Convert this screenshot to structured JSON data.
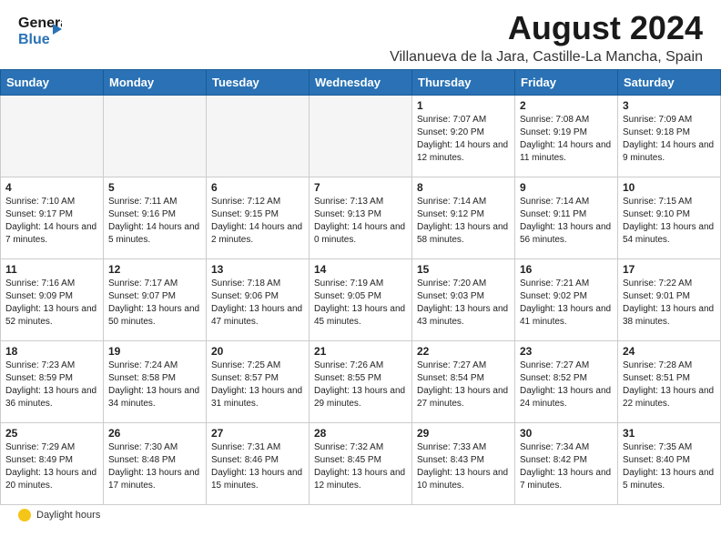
{
  "header": {
    "logo_line1": "General",
    "logo_line2": "Blue",
    "title": "August 2024",
    "subtitle": "Villanueva de la Jara, Castille-La Mancha, Spain"
  },
  "days_of_week": [
    "Sunday",
    "Monday",
    "Tuesday",
    "Wednesday",
    "Thursday",
    "Friday",
    "Saturday"
  ],
  "weeks": [
    [
      {
        "day": "",
        "empty": true
      },
      {
        "day": "",
        "empty": true
      },
      {
        "day": "",
        "empty": true
      },
      {
        "day": "",
        "empty": true
      },
      {
        "day": "1",
        "sunrise": "7:07 AM",
        "sunset": "9:20 PM",
        "daylight": "14 hours and 12 minutes."
      },
      {
        "day": "2",
        "sunrise": "7:08 AM",
        "sunset": "9:19 PM",
        "daylight": "14 hours and 11 minutes."
      },
      {
        "day": "3",
        "sunrise": "7:09 AM",
        "sunset": "9:18 PM",
        "daylight": "14 hours and 9 minutes."
      }
    ],
    [
      {
        "day": "4",
        "sunrise": "7:10 AM",
        "sunset": "9:17 PM",
        "daylight": "14 hours and 7 minutes."
      },
      {
        "day": "5",
        "sunrise": "7:11 AM",
        "sunset": "9:16 PM",
        "daylight": "14 hours and 5 minutes."
      },
      {
        "day": "6",
        "sunrise": "7:12 AM",
        "sunset": "9:15 PM",
        "daylight": "14 hours and 2 minutes."
      },
      {
        "day": "7",
        "sunrise": "7:13 AM",
        "sunset": "9:13 PM",
        "daylight": "14 hours and 0 minutes."
      },
      {
        "day": "8",
        "sunrise": "7:14 AM",
        "sunset": "9:12 PM",
        "daylight": "13 hours and 58 minutes."
      },
      {
        "day": "9",
        "sunrise": "7:14 AM",
        "sunset": "9:11 PM",
        "daylight": "13 hours and 56 minutes."
      },
      {
        "day": "10",
        "sunrise": "7:15 AM",
        "sunset": "9:10 PM",
        "daylight": "13 hours and 54 minutes."
      }
    ],
    [
      {
        "day": "11",
        "sunrise": "7:16 AM",
        "sunset": "9:09 PM",
        "daylight": "13 hours and 52 minutes."
      },
      {
        "day": "12",
        "sunrise": "7:17 AM",
        "sunset": "9:07 PM",
        "daylight": "13 hours and 50 minutes."
      },
      {
        "day": "13",
        "sunrise": "7:18 AM",
        "sunset": "9:06 PM",
        "daylight": "13 hours and 47 minutes."
      },
      {
        "day": "14",
        "sunrise": "7:19 AM",
        "sunset": "9:05 PM",
        "daylight": "13 hours and 45 minutes."
      },
      {
        "day": "15",
        "sunrise": "7:20 AM",
        "sunset": "9:03 PM",
        "daylight": "13 hours and 43 minutes."
      },
      {
        "day": "16",
        "sunrise": "7:21 AM",
        "sunset": "9:02 PM",
        "daylight": "13 hours and 41 minutes."
      },
      {
        "day": "17",
        "sunrise": "7:22 AM",
        "sunset": "9:01 PM",
        "daylight": "13 hours and 38 minutes."
      }
    ],
    [
      {
        "day": "18",
        "sunrise": "7:23 AM",
        "sunset": "8:59 PM",
        "daylight": "13 hours and 36 minutes."
      },
      {
        "day": "19",
        "sunrise": "7:24 AM",
        "sunset": "8:58 PM",
        "daylight": "13 hours and 34 minutes."
      },
      {
        "day": "20",
        "sunrise": "7:25 AM",
        "sunset": "8:57 PM",
        "daylight": "13 hours and 31 minutes."
      },
      {
        "day": "21",
        "sunrise": "7:26 AM",
        "sunset": "8:55 PM",
        "daylight": "13 hours and 29 minutes."
      },
      {
        "day": "22",
        "sunrise": "7:27 AM",
        "sunset": "8:54 PM",
        "daylight": "13 hours and 27 minutes."
      },
      {
        "day": "23",
        "sunrise": "7:27 AM",
        "sunset": "8:52 PM",
        "daylight": "13 hours and 24 minutes."
      },
      {
        "day": "24",
        "sunrise": "7:28 AM",
        "sunset": "8:51 PM",
        "daylight": "13 hours and 22 minutes."
      }
    ],
    [
      {
        "day": "25",
        "sunrise": "7:29 AM",
        "sunset": "8:49 PM",
        "daylight": "13 hours and 20 minutes."
      },
      {
        "day": "26",
        "sunrise": "7:30 AM",
        "sunset": "8:48 PM",
        "daylight": "13 hours and 17 minutes."
      },
      {
        "day": "27",
        "sunrise": "7:31 AM",
        "sunset": "8:46 PM",
        "daylight": "13 hours and 15 minutes."
      },
      {
        "day": "28",
        "sunrise": "7:32 AM",
        "sunset": "8:45 PM",
        "daylight": "13 hours and 12 minutes."
      },
      {
        "day": "29",
        "sunrise": "7:33 AM",
        "sunset": "8:43 PM",
        "daylight": "13 hours and 10 minutes."
      },
      {
        "day": "30",
        "sunrise": "7:34 AM",
        "sunset": "8:42 PM",
        "daylight": "13 hours and 7 minutes."
      },
      {
        "day": "31",
        "sunrise": "7:35 AM",
        "sunset": "8:40 PM",
        "daylight": "13 hours and 5 minutes."
      }
    ]
  ],
  "footer": {
    "label": "Daylight hours"
  },
  "colors": {
    "header_bg": "#2a72b5",
    "accent": "#2a72b5"
  }
}
